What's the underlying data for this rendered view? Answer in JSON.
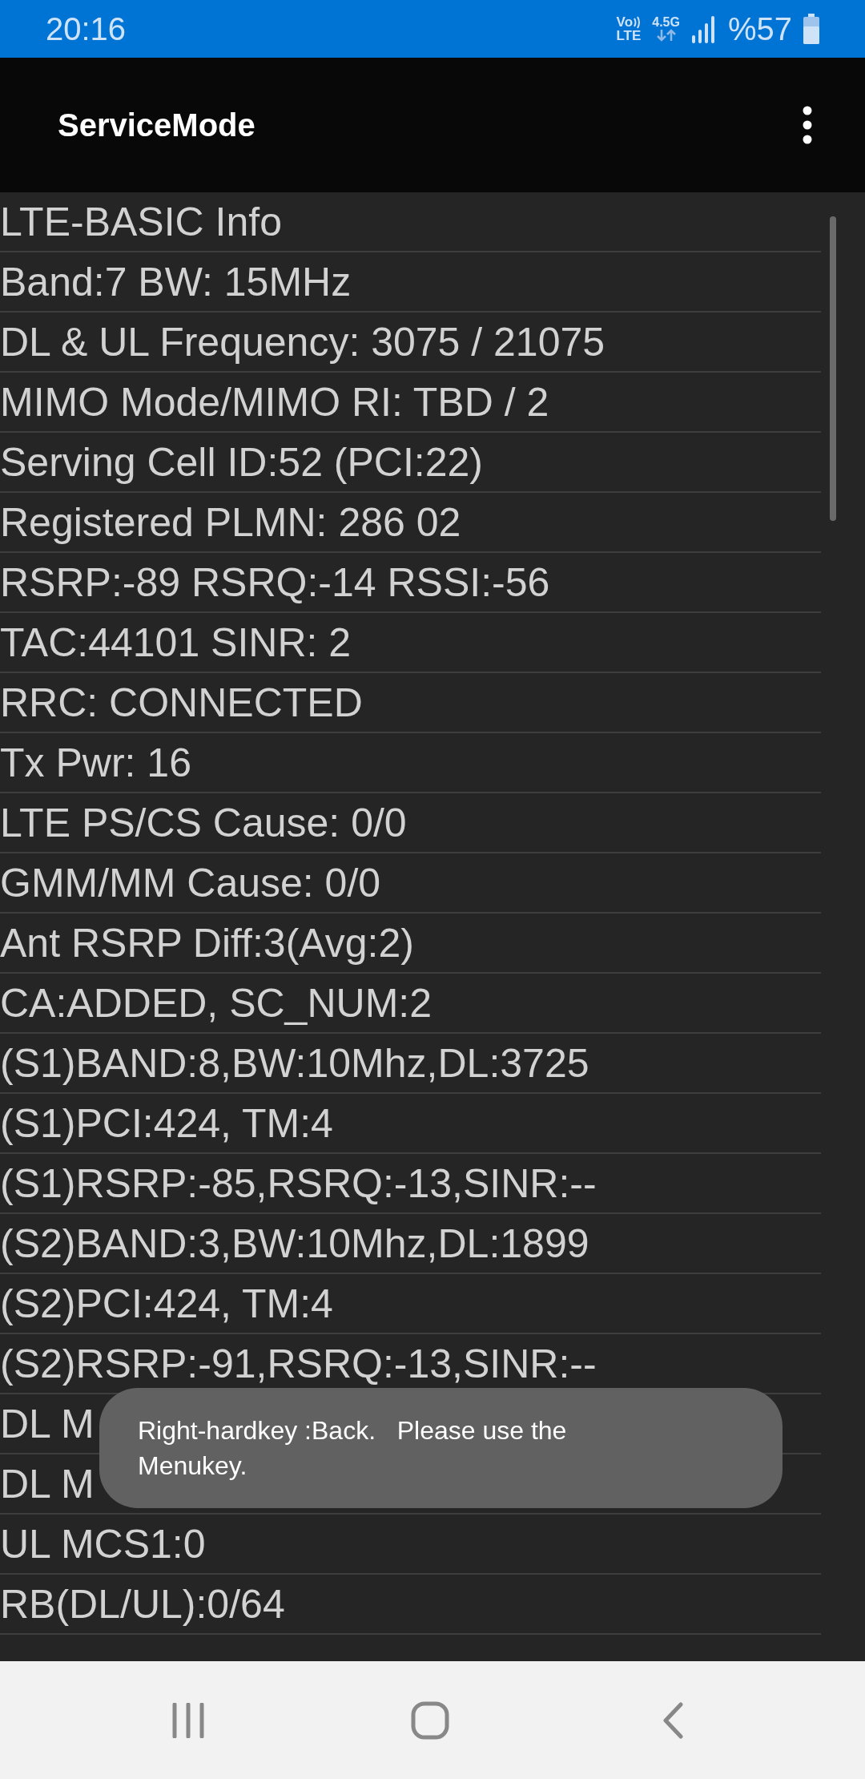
{
  "status_bar": {
    "time": "20:16",
    "volte_top": "Vo",
    "volte_bottom": "LTE",
    "network": "4.5G",
    "battery": "%57"
  },
  "app_bar": {
    "title": "ServiceMode"
  },
  "rows": [
    "LTE-BASIC Info",
    "Band:7 BW: 15MHz",
    "DL & UL Frequency: 3075 / 21075",
    "MIMO Mode/MIMO RI: TBD / 2",
    "Serving Cell ID:52 (PCI:22)",
    "Registered PLMN: 286 02",
    "RSRP:-89 RSRQ:-14 RSSI:-56",
    "TAC:44101 SINR: 2",
    "RRC: CONNECTED",
    "Tx Pwr: 16",
    "LTE PS/CS Cause: 0/0",
    "GMM/MM Cause: 0/0",
    "Ant RSRP Diff:3(Avg:2)",
    "CA:ADDED, SC_NUM:2",
    "(S1)BAND:8,BW:10Mhz,DL:3725",
    "(S1)PCI:424, TM:4",
    "(S1)RSRP:-85,RSRQ:-13,SINR:--",
    "(S2)BAND:3,BW:10Mhz,DL:1899",
    "(S2)PCI:424, TM:4",
    "(S2)RSRP:-91,RSRQ:-13,SINR:--",
    "DL M",
    "DL M",
    "UL MCS1:0",
    "RB(DL/UL):0/64"
  ],
  "toast": {
    "message": "Right-hardkey :Back.   Please use the Menukey."
  }
}
